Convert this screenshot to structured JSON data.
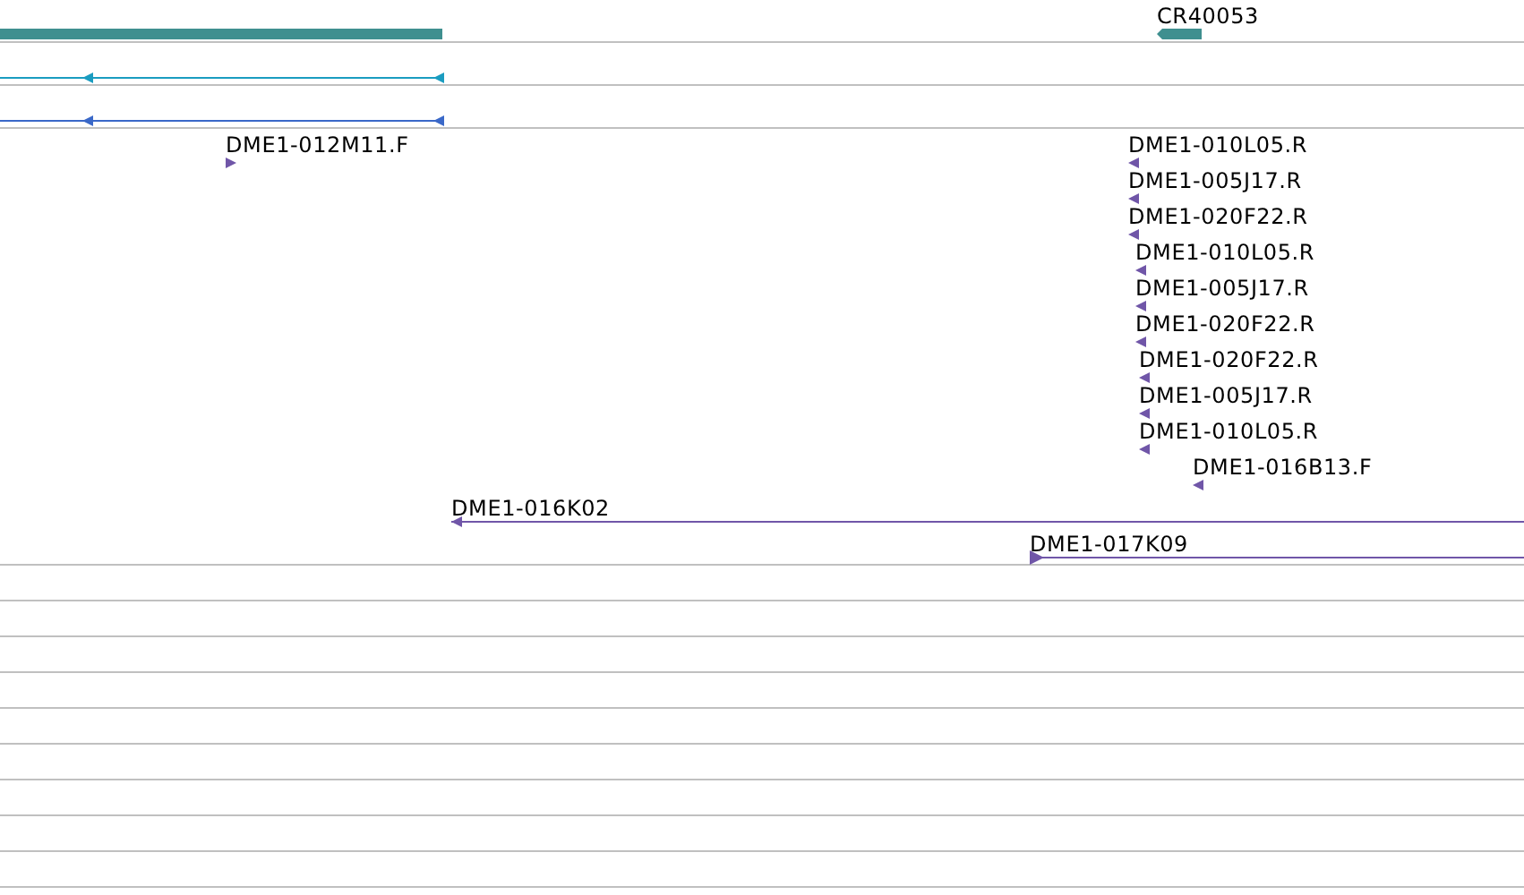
{
  "tracks": [
    {
      "kind": "gene",
      "color": "#3f8f8f",
      "features": [
        {
          "kind": "block"
        },
        {
          "kind": "arrow",
          "label": "CR40053",
          "reverse": true
        }
      ]
    },
    {
      "kind": "transcript",
      "color": "#1a9cc0",
      "features": [
        {
          "kind": "line",
          "reverse": true
        }
      ]
    },
    {
      "kind": "transcript",
      "color": "#3a68c8",
      "features": [
        {
          "kind": "line",
          "reverse": true
        }
      ]
    },
    {
      "kind": "clone",
      "color": "#7056a8",
      "features": [
        {
          "kind": "end",
          "label": "DME1-012M11.F",
          "reverse": false
        },
        {
          "kind": "end",
          "label": "DME1-010L05.R",
          "reverse": true
        },
        {
          "kind": "end",
          "label": "DME1-005J17.R",
          "reverse": true
        },
        {
          "kind": "end",
          "label": "DME1-020F22.R",
          "reverse": true
        },
        {
          "kind": "end",
          "label": "DME1-010L05.R",
          "reverse": true
        },
        {
          "kind": "end",
          "label": "DME1-005J17.R",
          "reverse": true
        },
        {
          "kind": "end",
          "label": "DME1-020F22.R",
          "reverse": true
        },
        {
          "kind": "end",
          "label": "DME1-020F22.R",
          "reverse": true
        },
        {
          "kind": "end",
          "label": "DME1-005J17.R",
          "reverse": true
        },
        {
          "kind": "end",
          "label": "DME1-010L05.R",
          "reverse": true
        },
        {
          "kind": "end",
          "label": "DME1-016B13.F",
          "reverse": true
        },
        {
          "kind": "span",
          "label": "DME1-016K02",
          "reverse": true
        },
        {
          "kind": "span",
          "label": "DME1-017K09",
          "reverse": false
        }
      ]
    }
  ]
}
